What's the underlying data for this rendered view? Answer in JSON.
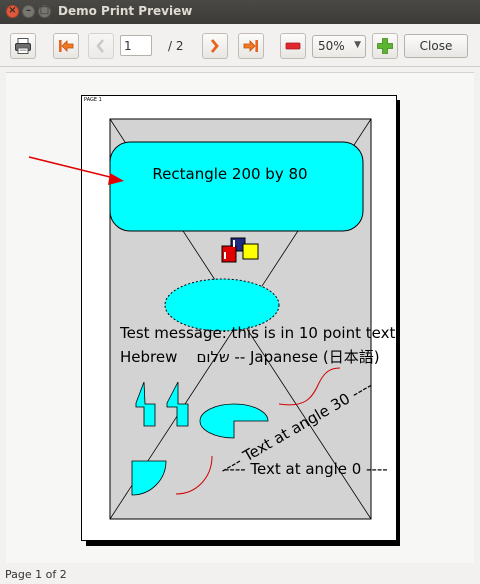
{
  "window": {
    "title": "Demo Print Preview",
    "controls": [
      "close-icon",
      "minimize-icon",
      "maximize-icon"
    ]
  },
  "toolbar": {
    "print_icon": "printer-icon",
    "first_icon": "first-page-icon",
    "prev_icon": "previous-page-icon",
    "page_value": "1",
    "page_total": "/ 2",
    "next_icon": "next-page-icon",
    "last_icon": "last-page-icon",
    "zoom_out_icon": "zoom-out-icon",
    "zoom_value": "50%",
    "zoom_in_icon": "zoom-in-icon",
    "close_label": "Close"
  },
  "preview": {
    "page_label": "PAGE 1",
    "rect_label": "Rectangle 200 by 80",
    "message": "Test message: this is in 10 point text",
    "hebrew_line": "Hebrew    שלום -- Japanese (日本語)",
    "angle30": "---- Text at angle 30 ----",
    "angle0": "---- Text at angle 0 ----",
    "colors": {
      "fill": "#00ffff",
      "page_bg": "#d3d3d3",
      "arrow": "#e00000",
      "arc": "#d00000"
    }
  },
  "status": {
    "text": "Page 1 of 2"
  }
}
